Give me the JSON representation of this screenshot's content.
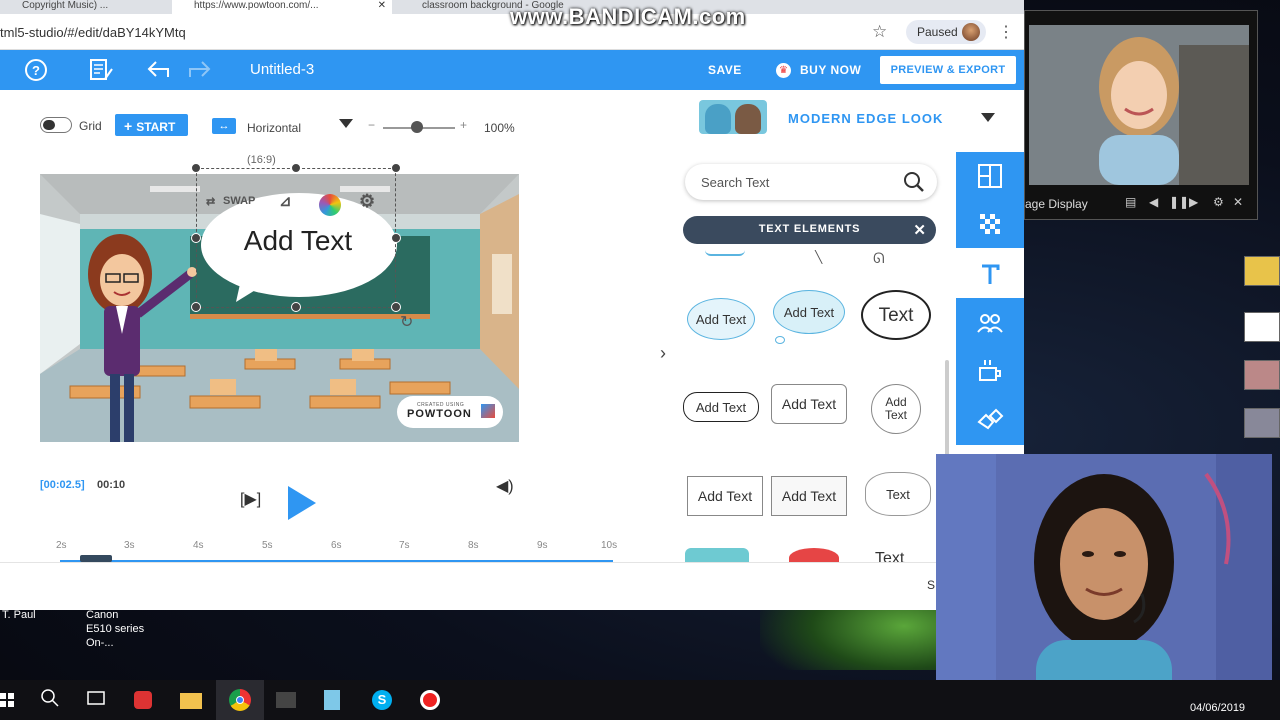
{
  "overlay": {
    "watermark": "www.BANDICAM.com"
  },
  "browser": {
    "tabs": [
      {
        "label": "Copyright Music) ...",
        "active": false
      },
      {
        "label": "https://www.powtoon.com/...",
        "active": true
      },
      {
        "label": "classroom background - Google",
        "active": false
      }
    ],
    "url": "tml5-studio/#/edit/daBY14kYMtq",
    "profile_status": "Paused"
  },
  "toolbar": {
    "title": "Untitled-3",
    "save_label": "SAVE",
    "buy_label": "BUY NOW",
    "export_label": "PREVIEW & EXPORT",
    "accent": "#2f96f2"
  },
  "controls": {
    "grid_label": "Grid",
    "start_label": "START",
    "orientation_label": "Horizontal",
    "zoom_minus": "−",
    "zoom_plus": "+",
    "zoom_value": "100%",
    "zoom_level": 1.0
  },
  "canvas": {
    "aspect": "(16:9)",
    "swap_label": "SWAP",
    "text_element": "Add Text",
    "watermark_line1": "CREATED USING",
    "watermark_line2": "POWTOON"
  },
  "playback": {
    "current_time": "[00:02.5]",
    "total_time": "00:10",
    "frame_label": "[▶]",
    "ticks": [
      "2s",
      "3s",
      "4s",
      "5s",
      "6s",
      "7s",
      "8s",
      "9s",
      "10s"
    ]
  },
  "library": {
    "style_label": "MODERN EDGE LOOK",
    "search_placeholder": "Search Text",
    "category_label": "TEXT ELEMENTS",
    "items": [
      {
        "text": "Add Text"
      },
      {
        "text": "Add Text"
      },
      {
        "text": "Text"
      },
      {
        "text": "Add Text"
      },
      {
        "text": "Add Text"
      },
      {
        "text": "Add Text"
      },
      {
        "text": "Add Text"
      },
      {
        "text": "Add Text"
      },
      {
        "text": "Text"
      },
      {
        "text": "Text"
      }
    ]
  },
  "side_icons": [
    "layout-icon",
    "background-icon",
    "text-icon",
    "characters-icon",
    "props-icon",
    "shapes-icon"
  ],
  "video_window": {
    "label": "age Display"
  },
  "desktop": {
    "labels": [
      {
        "text": "T. Paul"
      },
      {
        "text": "Canon E510 series On-..."
      }
    ],
    "date": "04/06/2019"
  }
}
